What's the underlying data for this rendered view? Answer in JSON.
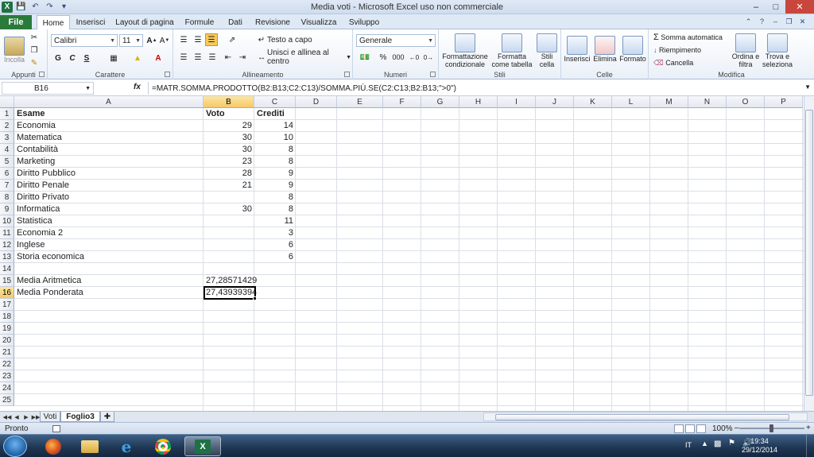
{
  "window": {
    "title": "Media voti  -  Microsoft Excel uso non commerciale",
    "app_icon_label": "X"
  },
  "ribbon_tabs": [
    "File",
    "Home",
    "Inserisci",
    "Layout di pagina",
    "Formule",
    "Dati",
    "Revisione",
    "Visualizza",
    "Sviluppo"
  ],
  "active_tab": "Home",
  "ribbon": {
    "clipboard": {
      "paste_label": "Incolla",
      "group_label": "Appunti"
    },
    "font": {
      "name": "Calibri",
      "size": "11",
      "bold": "G",
      "italic": "C",
      "underline": "S",
      "group_label": "Carattere"
    },
    "alignment": {
      "wrap_text": "Testo a capo",
      "merge_center": "Unisci e allinea al centro",
      "group_label": "Allineamento"
    },
    "number": {
      "format": "Generale",
      "percent": "%",
      "thousands": "000",
      "group_label": "Numeri"
    },
    "styles": {
      "conditional": "Formattazione condizionale",
      "table": "Formatta come tabella",
      "cell_styles": "Stili cella",
      "group_label": "Stili"
    },
    "cells": {
      "insert": "Inserisci",
      "delete": "Elimina",
      "format": "Formato",
      "group_label": "Celle"
    },
    "editing": {
      "autosum": "Somma automatica",
      "fill": "Riempimento",
      "clear": "Cancella",
      "sort_filter": "Ordina e filtra",
      "find_select": "Trova e seleziona",
      "group_label": "Modifica"
    }
  },
  "formula_bar": {
    "name_box": "B16",
    "fx": "fx",
    "formula": "=MATR.SOMMA.PRODOTTO(B2:B13;C2:C13)/SOMMA.PIÙ.SE(C2:C13;B2:B13;\">0\")"
  },
  "columns": [
    "A",
    "B",
    "C",
    "D",
    "E",
    "F",
    "G",
    "H",
    "I",
    "J",
    "K",
    "L",
    "M",
    "N",
    "O",
    "P"
  ],
  "row_numbers": [
    "1",
    "2",
    "3",
    "4",
    "5",
    "6",
    "7",
    "8",
    "9",
    "10",
    "11",
    "12",
    "13",
    "14",
    "15",
    "16",
    "17",
    "18",
    "19",
    "20",
    "21",
    "22",
    "23",
    "24",
    "25"
  ],
  "selected_cell": "B16",
  "sheet": {
    "header": {
      "a": "Esame",
      "b": "Voto",
      "c": "Crediti"
    },
    "rows": [
      {
        "a": "Economia",
        "b": "29",
        "c": "14"
      },
      {
        "a": "Matematica",
        "b": "30",
        "c": "10"
      },
      {
        "a": "Contabilità",
        "b": "30",
        "c": "8"
      },
      {
        "a": "Marketing",
        "b": "23",
        "c": "8"
      },
      {
        "a": "Diritto Pubblico",
        "b": "28",
        "c": "9"
      },
      {
        "a": "Diritto Penale",
        "b": "21",
        "c": "9"
      },
      {
        "a": "Diritto Privato",
        "b": "",
        "c": "8"
      },
      {
        "a": "Informatica",
        "b": "30",
        "c": "8"
      },
      {
        "a": "Statistica",
        "b": "",
        "c": "11"
      },
      {
        "a": "Economia 2",
        "b": "",
        "c": "3"
      },
      {
        "a": "Inglese",
        "b": "",
        "c": "6"
      },
      {
        "a": "Storia economica",
        "b": "",
        "c": "6"
      }
    ],
    "media_aritmetica": {
      "label": "Media Aritmetica",
      "value": "27,28571429"
    },
    "media_ponderata": {
      "label": "Media Ponderata",
      "value": "27,43939394"
    }
  },
  "sheet_tabs": [
    "Voti",
    "Foglio3"
  ],
  "active_sheet": "Foglio3",
  "status": {
    "mode": "Pronto",
    "zoom": "100%"
  },
  "taskbar": {
    "apps": [
      "firefox-icon",
      "explorer-icon",
      "internet-explorer-icon",
      "chrome-icon",
      "excel-icon"
    ],
    "lang": "IT",
    "time": "19:34",
    "date": "29/12/2014"
  }
}
